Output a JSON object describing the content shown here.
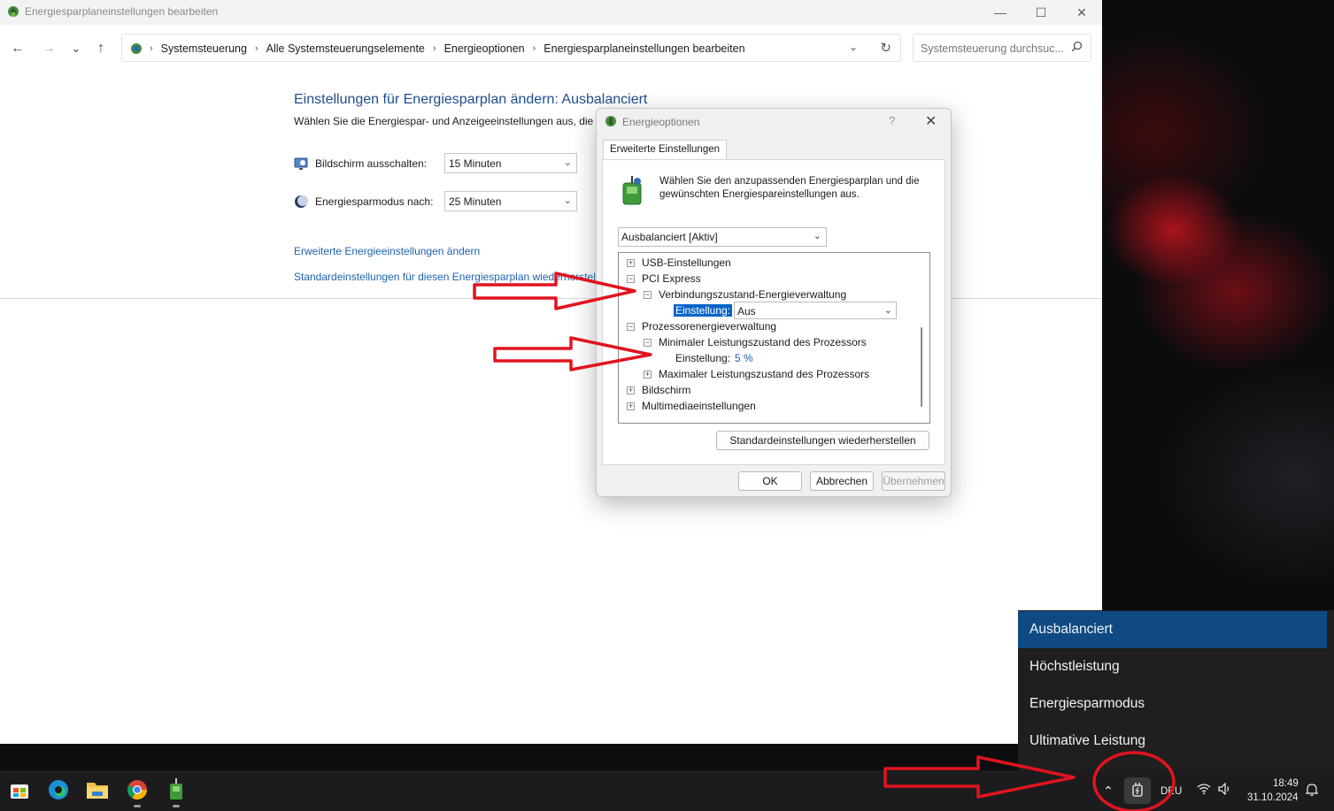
{
  "window": {
    "title": "Energiesparplaneinstellungen bearbeiten",
    "minimize": "—",
    "maximize": "☐",
    "close": "✕"
  },
  "nav": {
    "back": "←",
    "forward": "→",
    "recent": "⌄",
    "up": "↑"
  },
  "breadcrumb": [
    "Systemsteuerung",
    "Alle Systemsteuerungselemente",
    "Energieoptionen",
    "Energiesparplaneinstellungen bearbeiten"
  ],
  "search": {
    "placeholder": "Systemsteuerung durchsuc..."
  },
  "page": {
    "title": "Einstellungen für Energiesparplan ändern: Ausbalanciert",
    "subtitle": "Wählen Sie die Energiespar- und Anzeigeeinstellungen aus, die Si",
    "display_off_label": "Bildschirm ausschalten:",
    "display_off_value": "15 Minuten",
    "sleep_label": "Energiesparmodus nach:",
    "sleep_value": "25 Minuten",
    "advanced_link": "Erweiterte Energieeinstellungen ändern",
    "restore_link": "Standardeinstellungen für diesen Energiesparplan wiederherstelle"
  },
  "dialog": {
    "title": "Energieoptionen",
    "help": "?",
    "close": "✕",
    "tab": "Erweiterte Einstellungen",
    "intro": "Wählen Sie den anzupassenden Energiesparplan und die gewünschten Energiespareinstellungen aus.",
    "plan": "Ausbalanciert [Aktiv]",
    "tree": {
      "usb": "USB-Einstellungen",
      "pci": "PCI Express",
      "link_state": "Verbindungszustand-Energieverwaltung",
      "setting_label": "Einstellung:",
      "link_state_value": "Aus",
      "processor": "Prozessorenergieverwaltung",
      "min_state": "Minimaler Leistungszustand des Prozessors",
      "min_state_value": "5 %",
      "max_state": "Maximaler Leistungszustand des Prozessors",
      "display": "Bildschirm",
      "multimedia": "Multimediaeinstellungen"
    },
    "restore_button": "Standardeinstellungen wiederherstellen",
    "ok": "OK",
    "cancel": "Abbrechen",
    "apply": "Übernehmen"
  },
  "flyout": {
    "items": [
      "Ausbalanciert",
      "Höchstleistung",
      "Energiesparmodus",
      "Ultimative Leistung"
    ],
    "selected_index": 0
  },
  "taskbar": {
    "language": "DEU",
    "time": "18:49",
    "date": "31.10.2024"
  },
  "colors": {
    "accent": "#0a64c9",
    "link": "#1e62b0",
    "title_blue": "#1e4e8c",
    "annotation_red": "#e0141e",
    "flyout_selected": "#0f4a84"
  }
}
